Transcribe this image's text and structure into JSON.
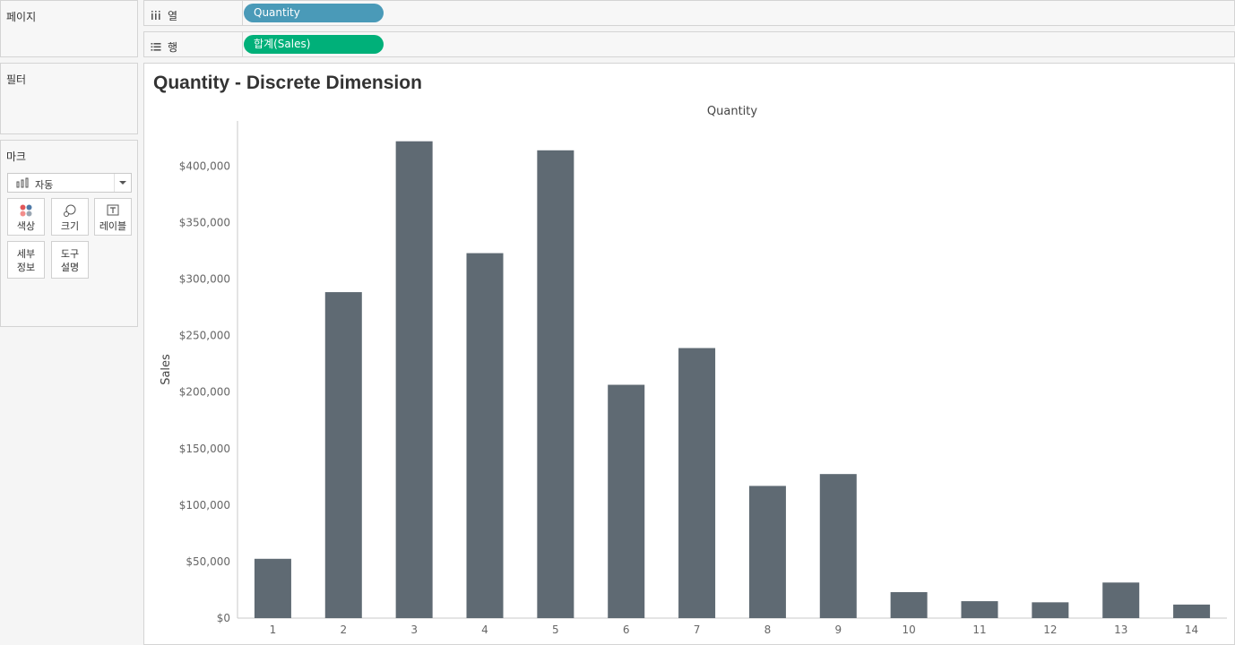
{
  "left_pane": {
    "pages_title": "페이지",
    "filters_title": "필터",
    "marks_title": "마크",
    "mark_type": "자동",
    "cards": {
      "color": "색상",
      "size": "크기",
      "label": "레이블",
      "detail": "세부\n정보",
      "tooltip": "도구\n설명"
    }
  },
  "shelves": {
    "columns_label": "열",
    "columns_pill": "Quantity",
    "columns_pill_color": "#4a9ab8",
    "rows_label": "행",
    "rows_pill": "합계(Sales)",
    "rows_pill_color": "#00b079"
  },
  "sheet": {
    "title": "Quantity - Discrete Dimension"
  },
  "chart_data": {
    "type": "bar",
    "title": "Quantity - Discrete Dimension",
    "header_label": "Quantity",
    "xlabel": "",
    "ylabel": "Sales",
    "categories": [
      "1",
      "2",
      "3",
      "4",
      "5",
      "6",
      "7",
      "8",
      "9",
      "10",
      "11",
      "12",
      "13",
      "14"
    ],
    "values": [
      52500,
      288500,
      422000,
      323000,
      414000,
      206500,
      239000,
      117000,
      127500,
      23000,
      15000,
      14000,
      31500,
      12000
    ],
    "ylim": [
      0,
      440000
    ],
    "yticks": [
      0,
      50000,
      100000,
      150000,
      200000,
      250000,
      300000,
      350000,
      400000
    ],
    "ytick_labels": [
      "$0",
      "$50,000",
      "$100,000",
      "$150,000",
      "$200,000",
      "$250,000",
      "$300,000",
      "$350,000",
      "$400,000"
    ],
    "bar_color": "#5f6a73",
    "grid": false
  }
}
